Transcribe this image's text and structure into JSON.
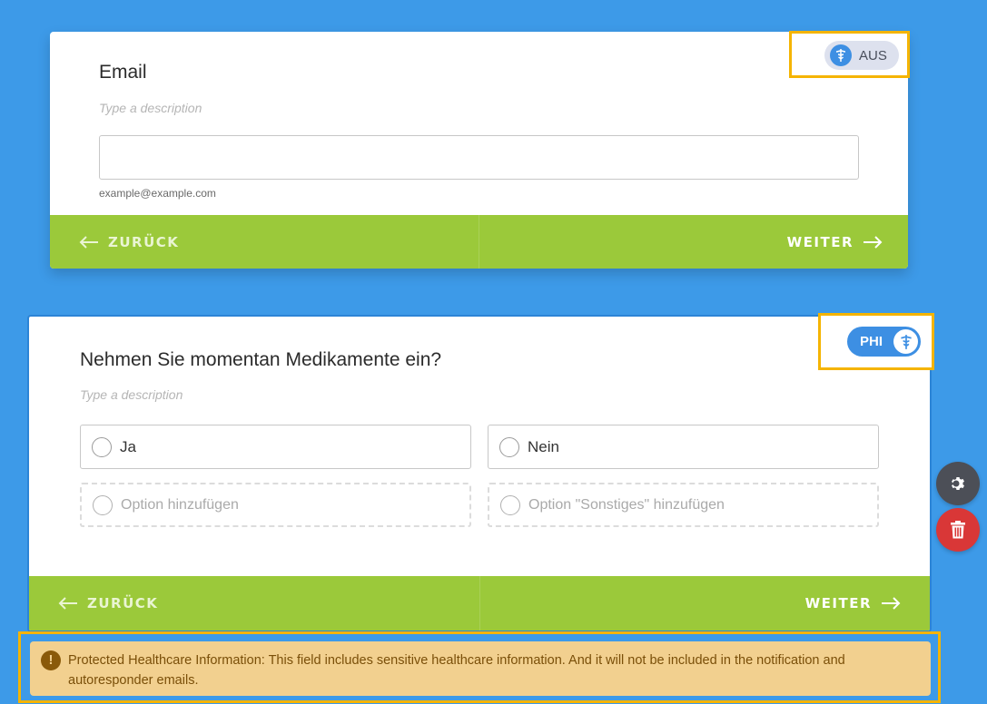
{
  "email_card": {
    "title": "Email",
    "description_placeholder": "Type a description",
    "input_value": "",
    "sublabel": "example@example.com",
    "phi_toggle_label": "AUS",
    "back_label": "ZURÜCK",
    "next_label": "WEITER"
  },
  "medication_card": {
    "title": "Nehmen Sie momentan Medikamente ein?",
    "description_placeholder": "Type a description",
    "options": [
      "Ja",
      "Nein"
    ],
    "add_option_label": "Option hinzufügen",
    "add_other_label": "Option \"Sonstiges\" hinzufügen",
    "phi_toggle_label": "PHI",
    "back_label": "ZURÜCK",
    "next_label": "WEITER"
  },
  "side_actions": {
    "settings_icon": "gear-icon",
    "delete_icon": "trash-icon"
  },
  "warning": {
    "text": "Protected Healthcare Information: This field includes sensitive healthcare information. And it will not be included in the notification and autoresponder emails."
  },
  "colors": {
    "background": "#3d9ae8",
    "nav_green": "#9bc93a",
    "toggle_blue": "#3d8fe3",
    "highlight": "#f5b400",
    "delete_red": "#d93737",
    "warning_bg": "#f2d08f"
  }
}
